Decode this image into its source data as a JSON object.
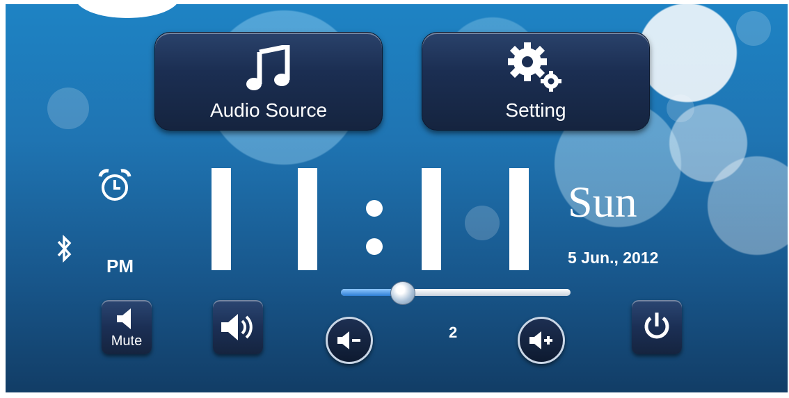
{
  "buttons": {
    "audio_source": {
      "label": "Audio Source",
      "icon": "music-note-icon"
    },
    "setting": {
      "label": "Setting",
      "icon": "gears-icon"
    },
    "mute": {
      "label": "Mute",
      "icon": "speaker-mute-icon"
    }
  },
  "clock": {
    "display": "11:11",
    "period": "PM",
    "day": "Sun",
    "date": "5 Jun., 2012"
  },
  "volume": {
    "level": "2",
    "slider_fraction": 0.24
  },
  "status_icons": [
    "alarm-clock-icon",
    "bluetooth-icon"
  ],
  "colors": {
    "button_fill": "#1b2e52",
    "background": "#1f74b2",
    "text": "#ffffff"
  }
}
